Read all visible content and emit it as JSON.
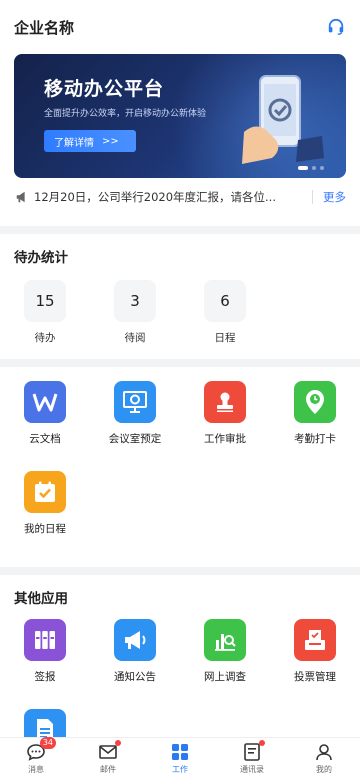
{
  "header": {
    "title": "企业名称",
    "support_icon": "headset-icon"
  },
  "banner": {
    "title": "移动办公平台",
    "subtitle": "全面提升办公效率，开启移动办公新体验",
    "button_label": "了解详情",
    "button_arrow": ">>",
    "slides": 3,
    "active_slide": 1
  },
  "notice": {
    "icon": "megaphone-icon",
    "text": "12月20日，公司举行2020年度汇报，请各位...",
    "more_label": "更多"
  },
  "pending": {
    "title": "待办统计",
    "items": [
      {
        "value": "15",
        "label": "待办"
      },
      {
        "value": "3",
        "label": "待阅"
      },
      {
        "value": "6",
        "label": "日程"
      }
    ]
  },
  "work_apps": [
    {
      "label": "云文档",
      "icon": "wps-doc-icon",
      "color": "#4a73e8"
    },
    {
      "label": "会议室预定",
      "icon": "meeting-room-icon",
      "color": "#2e92f2"
    },
    {
      "label": "工作审批",
      "icon": "approval-stamp-icon",
      "color": "#ef4b3b"
    },
    {
      "label": "考勤打卡",
      "icon": "location-clock-icon",
      "color": "#3fc24a"
    },
    {
      "label": "我的日程",
      "icon": "calendar-icon",
      "color": "#f7a51d"
    }
  ],
  "other_apps": {
    "title": "其他应用",
    "items": [
      {
        "label": "签报",
        "icon": "binders-icon",
        "color": "#8a52d6"
      },
      {
        "label": "通知公告",
        "icon": "megaphone-icon",
        "color": "#2e92f2"
      },
      {
        "label": "网上调查",
        "icon": "survey-icon",
        "color": "#3fc24a"
      },
      {
        "label": "投票管理",
        "icon": "ballot-box-icon",
        "color": "#ef4b3b"
      },
      {
        "label": "",
        "icon": "document-icon",
        "color": "#2e92f2"
      }
    ]
  },
  "tabbar": [
    {
      "label": "消息",
      "icon": "chat-bubble-icon",
      "badge": "34"
    },
    {
      "label": "邮件",
      "icon": "mail-icon",
      "dot": true
    },
    {
      "label": "工作",
      "icon": "grid-icon",
      "active": true
    },
    {
      "label": "通讯录",
      "icon": "contacts-book-icon",
      "dot": true
    },
    {
      "label": "我的",
      "icon": "user-icon"
    }
  ],
  "colors": {
    "accent": "#2a7bf2",
    "badge": "#f34343"
  }
}
